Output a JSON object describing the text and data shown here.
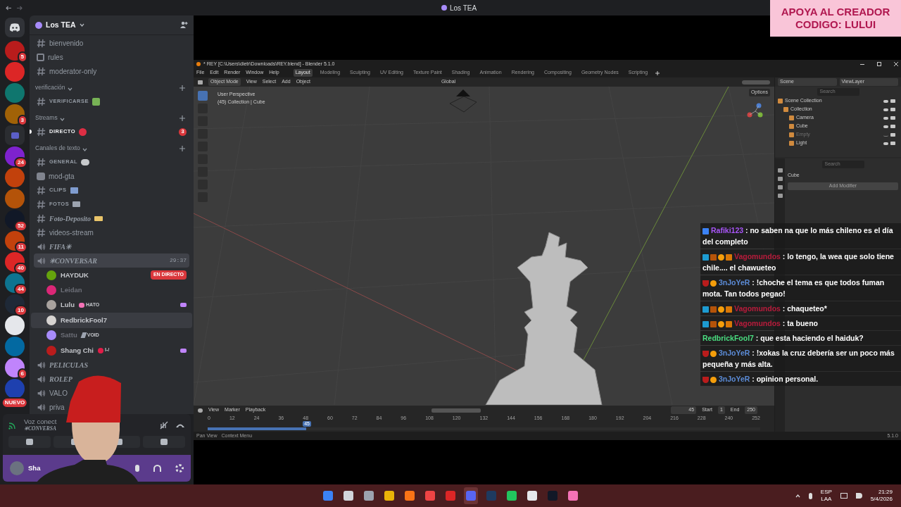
{
  "topbar": {
    "title": "Los TEA"
  },
  "promo": {
    "line1": "APOYA AL CREADOR",
    "line2": "CODIGO: LULUI"
  },
  "servers": [
    {
      "color": "#b91c1c",
      "badge": "5"
    },
    {
      "color": "#dc2626"
    },
    {
      "color": "#0f766e"
    },
    {
      "color": "#a16207",
      "badge": "3"
    },
    {
      "color": "#5b5fc7",
      "kind": "folder"
    },
    {
      "color": "#7e22ce",
      "badge": "24"
    },
    {
      "color": "#c2410c"
    },
    {
      "color": "#b45309"
    },
    {
      "color": "#111827",
      "badge": "52"
    },
    {
      "color": "#c2410c",
      "badge": "11"
    },
    {
      "color": "#dc2626",
      "badge": "40"
    },
    {
      "color": "#0e7490",
      "badge": "44"
    },
    {
      "color": "#1f2937",
      "badge": "10"
    },
    {
      "color": "#e5e7eb"
    },
    {
      "color": "#0369a1"
    },
    {
      "color": "#c084fc",
      "badge": "6"
    },
    {
      "color": "#1e40af",
      "badge": "NUEVO"
    }
  ],
  "server": {
    "name": "Los TEA"
  },
  "channels": [
    {
      "kind": "text",
      "name": "bienvenido"
    },
    {
      "kind": "rules",
      "name": "rules"
    },
    {
      "kind": "text",
      "name": "moderator-only"
    },
    {
      "kind": "category",
      "name": "verificación"
    },
    {
      "kind": "text",
      "name": "VERIFICARSE",
      "small_caps": true,
      "emoji": {
        "kind": "check"
      }
    },
    {
      "kind": "category",
      "name": "Streams"
    },
    {
      "kind": "text",
      "name": "DIRECTO",
      "small_caps": true,
      "emoji": {
        "kind": "dot"
      },
      "unread": true,
      "count": "3"
    },
    {
      "kind": "category",
      "name": "Canales de texto"
    },
    {
      "kind": "text",
      "name": "GENERAL",
      "small_caps": true,
      "emoji": {
        "kind": "bubble"
      }
    },
    {
      "kind": "forum",
      "name": "mod-gta"
    },
    {
      "kind": "text",
      "name": "CLIPS",
      "small_caps": true,
      "emoji": {
        "kind": "film"
      }
    },
    {
      "kind": "text",
      "name": "FOTOS",
      "small_caps": true,
      "emoji": {
        "kind": "camera"
      }
    },
    {
      "kind": "text",
      "name": "Foto-Deposito",
      "italic": true,
      "emoji": {
        "kind": "ticket"
      }
    },
    {
      "kind": "text",
      "name": "videos-stream"
    },
    {
      "kind": "voice",
      "name": "FIFA✳",
      "italic": true
    },
    {
      "kind": "voice",
      "name": "✳CONVERSAR",
      "italic": true,
      "selected": true,
      "timer": "29:37",
      "members": [
        {
          "name": "HAYDUK",
          "idle": false,
          "hovered": false,
          "live": "EN DIRECTO",
          "color": "#65a30d"
        },
        {
          "name": "Leidan",
          "idle": true,
          "hovered": false,
          "color": "#db2777"
        },
        {
          "name": "Lulu",
          "idle": false,
          "hovered": false,
          "tag": {
            "kind": "heart",
            "label": "HATO"
          },
          "activity": true,
          "color": "#a8a29e"
        },
        {
          "name": "RedbrickFool7",
          "idle": false,
          "hovered": true,
          "color": "#d6d3d1"
        },
        {
          "name": "Sattu",
          "idle": true,
          "hovered": false,
          "tag": {
            "kind": "bolt",
            "label": "VOID"
          },
          "color": "#a78bfa"
        },
        {
          "name": "Shang Chi",
          "idle": false,
          "hovered": false,
          "tag": {
            "kind": "face",
            "label": "I-/"
          },
          "activity": true,
          "color": "#b91c1c"
        }
      ]
    },
    {
      "kind": "voice",
      "name": "PELICULAS",
      "italic": true
    },
    {
      "kind": "voice",
      "name": "ROLEP",
      "italic": true
    },
    {
      "kind": "voice",
      "name": "VALO"
    },
    {
      "kind": "voice",
      "name": "priva"
    }
  ],
  "voice_panel": {
    "status": "Voz conect",
    "channel": "✳CONVERSA"
  },
  "user_panel": {
    "name": "Sha"
  },
  "blender": {
    "title": "* REY [C:\\Users\\dietr\\Downloads\\REY.blend] - Blender 5.1.0",
    "menus": [
      "File",
      "Edit",
      "Render",
      "Window",
      "Help"
    ],
    "workspaces": [
      {
        "label": "Layout",
        "selected": true
      },
      {
        "label": "Modeling",
        "selected": false
      },
      {
        "label": "Sculpting",
        "selected": false
      },
      {
        "label": "UV Editing",
        "selected": false
      },
      {
        "label": "Texture Paint",
        "selected": false
      },
      {
        "label": "Shading",
        "selected": false
      },
      {
        "label": "Animation",
        "selected": false
      },
      {
        "label": "Rendering",
        "selected": false
      },
      {
        "label": "Compositing",
        "selected": false
      },
      {
        "label": "Geometry Nodes",
        "selected": false
      },
      {
        "label": "Scripting",
        "selected": false
      }
    ],
    "mode": "Object Mode",
    "header_menus": [
      "View",
      "Select",
      "Add",
      "Object"
    ],
    "orientation": "Global",
    "options": "Options",
    "viewport_info": [
      "User Perspective",
      "(45) Collection | Cube"
    ],
    "outliner": {
      "scene": "Scene",
      "view_layer": "ViewLayer",
      "search": "Search",
      "tree": [
        {
          "name": "Scene Collection",
          "visible": true,
          "children": [
            {
              "name": "Collection",
              "visible": true,
              "children": [
                {
                  "name": "Camera",
                  "visible": true
                },
                {
                  "name": "Cube",
                  "visible": true
                },
                {
                  "name": "Empty",
                  "visible": false
                },
                {
                  "name": "Light",
                  "visible": true
                }
              ]
            }
          ]
        }
      ]
    },
    "properties": {
      "search": "Search",
      "object": "Cube",
      "button": "Add Modifier"
    },
    "timeline": {
      "menus": [
        "View",
        "Marker",
        "Playback"
      ],
      "frame": "45",
      "start_label": "Start",
      "start": "1",
      "end_label": "End",
      "end": "250",
      "ticks": [
        "0",
        "12",
        "24",
        "36",
        "48",
        "60",
        "72",
        "84",
        "96",
        "108",
        "120",
        "132",
        "144",
        "156",
        "168",
        "180",
        "192",
        "204",
        "216",
        "228",
        "240",
        "252"
      ],
      "current": "45",
      "level": 0.1786
    },
    "status": {
      "items": [
        "Pan View",
        "Context Menu"
      ],
      "version": "5.1.0"
    }
  },
  "chat": [
    {
      "user": "Rafiki123",
      "color": "#a855f7",
      "badges": [
        {
          "kind": "cube"
        }
      ],
      "text": ": no saben na que lo más chileno es el día del completo"
    },
    {
      "user": "Vagomundos",
      "color": "#b91c3c",
      "badges": [
        {
          "kind": "arrow"
        },
        {
          "kind": "figure"
        },
        {
          "kind": "coin"
        },
        {
          "kind": "crown"
        }
      ],
      "text": ": lo tengo, la wea que solo tiene chile.... el chawueteo"
    },
    {
      "user": "3nJoYeR",
      "color": "#5b8bd6",
      "badges": [
        {
          "kind": "bowl"
        },
        {
          "kind": "coin"
        }
      ],
      "text": ": !choche el tema es que todos fuman mota. Tan todos pegao!"
    },
    {
      "user": "Vagomundos",
      "color": "#b91c3c",
      "badges": [
        {
          "kind": "arrow"
        },
        {
          "kind": "figure"
        },
        {
          "kind": "coin"
        },
        {
          "kind": "crown"
        }
      ],
      "text": ": chaqueteo*"
    },
    {
      "user": "Vagomundos",
      "color": "#b91c3c",
      "badges": [
        {
          "kind": "arrow"
        },
        {
          "kind": "figure"
        },
        {
          "kind": "coin"
        },
        {
          "kind": "crown"
        }
      ],
      "text": ": ta bueno"
    },
    {
      "user": "RedbrickFool7",
      "color": "#4ade80",
      "text": ": que esta haciendo el haiduk?"
    },
    {
      "user": "3nJoYeR",
      "color": "#5b8bd6",
      "badges": [
        {
          "kind": "bowl"
        },
        {
          "kind": "coin"
        }
      ],
      "text": ": !xokas la cruz debería ser un poco más pequeña y más alta."
    },
    {
      "user": "3nJoYeR",
      "color": "#5b8bd6",
      "badges": [
        {
          "kind": "bowl"
        },
        {
          "kind": "coin"
        }
      ],
      "text": ": opinion personal."
    }
  ],
  "taskbar": {
    "apps": [
      {
        "kind": "start",
        "active": false
      },
      {
        "kind": "search",
        "active": false
      },
      {
        "kind": "taskview",
        "active": false
      },
      {
        "kind": "folder",
        "active": false
      },
      {
        "kind": "brave",
        "active": false
      },
      {
        "kind": "play",
        "active": false
      },
      {
        "kind": "affinity",
        "active": false
      },
      {
        "kind": "discord",
        "active": true
      },
      {
        "kind": "steam",
        "active": false
      },
      {
        "kind": "spotify",
        "active": false
      },
      {
        "kind": "obs",
        "active": false
      },
      {
        "kind": "epic",
        "active": false
      },
      {
        "kind": "vtube",
        "active": false
      }
    ],
    "lang": "ESP",
    "layout": "LAA",
    "time": "21:29",
    "date": "5/4/2026"
  }
}
